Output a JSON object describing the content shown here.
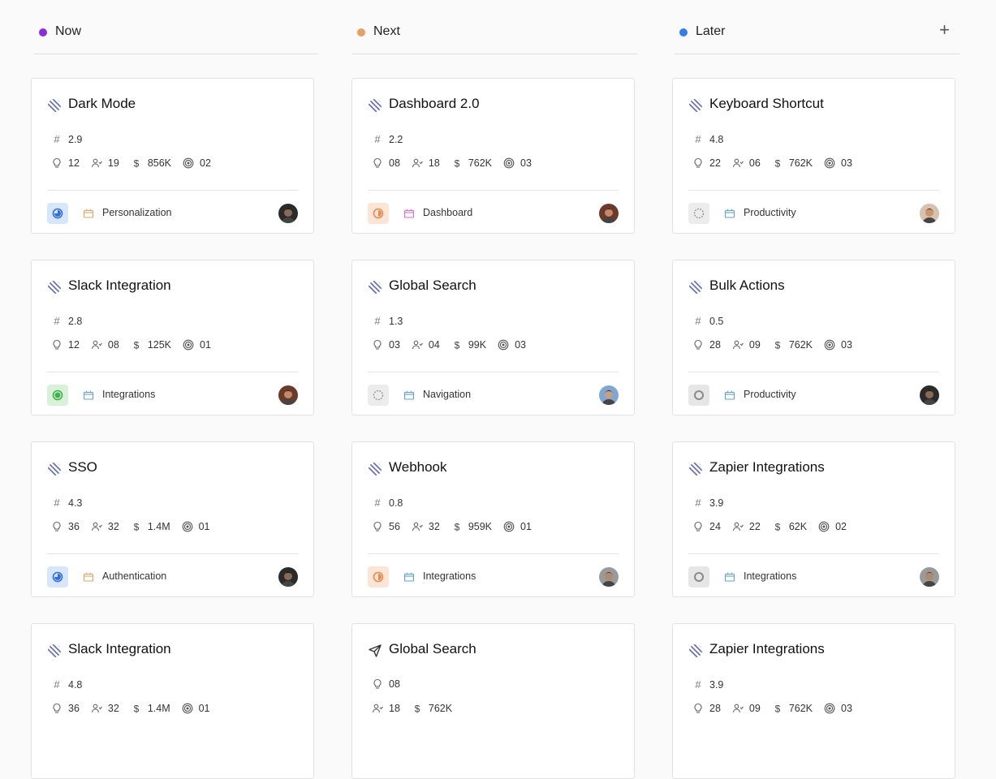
{
  "columns": [
    {
      "title": "Now",
      "dot_color": "#8a2be2"
    },
    {
      "title": "Next",
      "dot_color": "#e8a060"
    },
    {
      "title": "Later",
      "dot_color": "#2f7df6"
    }
  ],
  "add_label": "+",
  "cards": [
    {
      "title": "Dark Mode",
      "icon": "linear-icon",
      "score": "2.9",
      "ideas": "12",
      "users": "19",
      "revenue": "856K",
      "goals": "02",
      "status": "in-progress",
      "tag": "Personalization",
      "tag_color": "#e8a060",
      "avatar": "dark"
    },
    {
      "title": "Dashboard 2.0",
      "icon": "linear-icon",
      "score": "2.2",
      "ideas": "08",
      "users": "18",
      "revenue": "762K",
      "goals": "03",
      "status": "planned",
      "tag": "Dashboard",
      "tag_color": "#d96bd6",
      "avatar": "warm"
    },
    {
      "title": "Keyboard Shortcut",
      "icon": "linear-icon",
      "score": "4.8",
      "ideas": "22",
      "users": "06",
      "revenue": "762K",
      "goals": "03",
      "status": "backlog",
      "tag": "Productivity",
      "tag_color": "#5aa0e0",
      "avatar": "light"
    },
    {
      "title": "Slack Integration",
      "icon": "linear-icon",
      "score": "2.8",
      "ideas": "12",
      "users": "08",
      "revenue": "125K",
      "goals": "01",
      "status": "done",
      "tag": "Integrations",
      "tag_color": "#5aa0e0",
      "avatar": "warm"
    },
    {
      "title": "Global Search",
      "icon": "linear-icon",
      "score": "1.3",
      "ideas": "03",
      "users": "04",
      "revenue": "99K",
      "goals": "03",
      "status": "backlog",
      "tag": "Navigation",
      "tag_color": "#5aa0e0",
      "avatar": "blue"
    },
    {
      "title": "Bulk Actions",
      "icon": "linear-icon",
      "score": "0.5",
      "ideas": "28",
      "users": "09",
      "revenue": "762K",
      "goals": "03",
      "status": "todo",
      "tag": "Productivity",
      "tag_color": "#5aa0e0",
      "avatar": "dark"
    },
    {
      "title": "SSO",
      "icon": "linear-icon",
      "score": "4.3",
      "ideas": "36",
      "users": "32",
      "revenue": "1.4M",
      "goals": "01",
      "status": "in-progress",
      "tag": "Authentication",
      "tag_color": "#e8a060",
      "avatar": "dark"
    },
    {
      "title": "Webhook",
      "icon": "linear-icon",
      "score": "0.8",
      "ideas": "56",
      "users": "32",
      "revenue": "959K",
      "goals": "01",
      "status": "planned",
      "tag": "Integrations",
      "tag_color": "#5aa0e0",
      "avatar": "gray"
    },
    {
      "title": "Zapier Integrations",
      "icon": "linear-icon",
      "score": "3.9",
      "ideas": "24",
      "users": "22",
      "revenue": "62K",
      "goals": "02",
      "status": "todo",
      "tag": "Integrations",
      "tag_color": "#5aa0e0",
      "avatar": "gray"
    },
    {
      "title": "Slack Integration",
      "icon": "linear-icon",
      "score": "4.8",
      "ideas": "36",
      "users": "32",
      "revenue": "1.4M",
      "goals": "01"
    },
    {
      "title": "Global Search",
      "icon": "paper-plane-icon",
      "ideas": "08",
      "users": "18",
      "revenue": "762K"
    },
    {
      "title": "Zapier Integrations",
      "icon": "linear-icon",
      "score": "3.9",
      "ideas": "28",
      "users": "09",
      "revenue": "762K",
      "goals": "03"
    }
  ]
}
